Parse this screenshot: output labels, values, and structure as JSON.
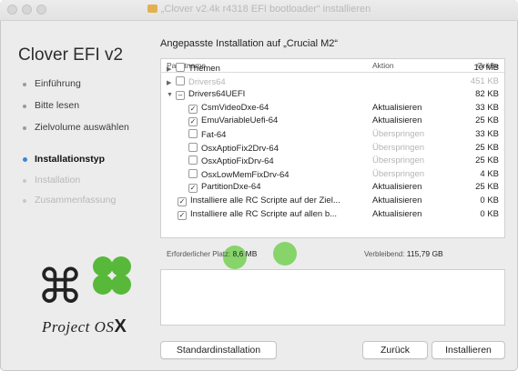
{
  "window": {
    "title": "„Clover v2.4k r4318 EFI bootloader“ installieren"
  },
  "sidebar": {
    "title": "Clover EFI v2",
    "steps": [
      {
        "label": "Einführung",
        "state": "done"
      },
      {
        "label": "Bitte lesen",
        "state": "done"
      },
      {
        "label": "Zielvolume auswählen",
        "state": "done"
      },
      {
        "label": "Installationstyp",
        "state": "active"
      },
      {
        "label": "Installation",
        "state": "pending"
      },
      {
        "label": "Zusammenfassung",
        "state": "pending"
      }
    ],
    "logo": {
      "word1": "Project",
      "word2": "OS",
      "word3": "X"
    }
  },
  "main": {
    "title": "Angepasste Installation auf „Crucial M2“",
    "columns": {
      "name": "Paketname",
      "action": "Aktion",
      "size": "Größe"
    },
    "rows": [
      {
        "name": "Themen",
        "action": "",
        "size": "10 MB",
        "level": 0,
        "expander": "closed",
        "checked": false,
        "dim": false
      },
      {
        "name": "Drivers64",
        "action": "",
        "size": "451 KB",
        "level": 0,
        "expander": "closed",
        "checked": false,
        "dim": true
      },
      {
        "name": "Drivers64UEFI",
        "action": "",
        "size": "82 KB",
        "level": 0,
        "expander": "open",
        "checked": "mixed",
        "dim": false
      },
      {
        "name": "CsmVideoDxe-64",
        "action": "Aktualisieren",
        "size": "33 KB",
        "level": 1,
        "checked": true,
        "dim": false
      },
      {
        "name": "EmuVariableUefi-64",
        "action": "Aktualisieren",
        "size": "25 KB",
        "level": 1,
        "checked": true,
        "dim": false
      },
      {
        "name": "Fat-64",
        "action": "Überspringen",
        "size": "33 KB",
        "level": 1,
        "checked": false,
        "dim": false
      },
      {
        "name": "OsxAptioFix2Drv-64",
        "action": "Überspringen",
        "size": "25 KB",
        "level": 1,
        "checked": false,
        "dim": false
      },
      {
        "name": "OsxAptioFixDrv-64",
        "action": "Überspringen",
        "size": "25 KB",
        "level": 1,
        "checked": false,
        "dim": false
      },
      {
        "name": "OsxLowMemFixDrv-64",
        "action": "Überspringen",
        "size": "4 KB",
        "level": 1,
        "checked": false,
        "dim": false
      },
      {
        "name": "PartitionDxe-64",
        "action": "Aktualisieren",
        "size": "25 KB",
        "level": 1,
        "checked": true,
        "dim": false
      },
      {
        "name": "Installiere alle RC Scripte auf der Ziel...",
        "action": "Aktualisieren",
        "size": "0 KB",
        "level": 0,
        "checked": true,
        "dim": false
      },
      {
        "name": "Installiere alle RC Scripte auf allen b...",
        "action": "Aktualisieren",
        "size": "0 KB",
        "level": 0,
        "checked": true,
        "dim": false
      }
    ],
    "required_label": "Erforderlicher Platz:",
    "required_value": "8,6 MB",
    "remaining_label": "Verbleibend:",
    "remaining_value": "115,79 GB"
  },
  "buttons": {
    "standard": "Standardinstallation",
    "back": "Zurück",
    "install": "Installieren"
  },
  "colors": {
    "accent": "#3f83df",
    "clover": "#58b83a",
    "package": "#e2b14f"
  },
  "icons": [
    "traffic-light-close",
    "traffic-light-minimize",
    "traffic-light-zoom",
    "package-icon",
    "command-icon",
    "clover-leaf-icon",
    "disclosure-triangle-icon",
    "checkbox-icon"
  ]
}
